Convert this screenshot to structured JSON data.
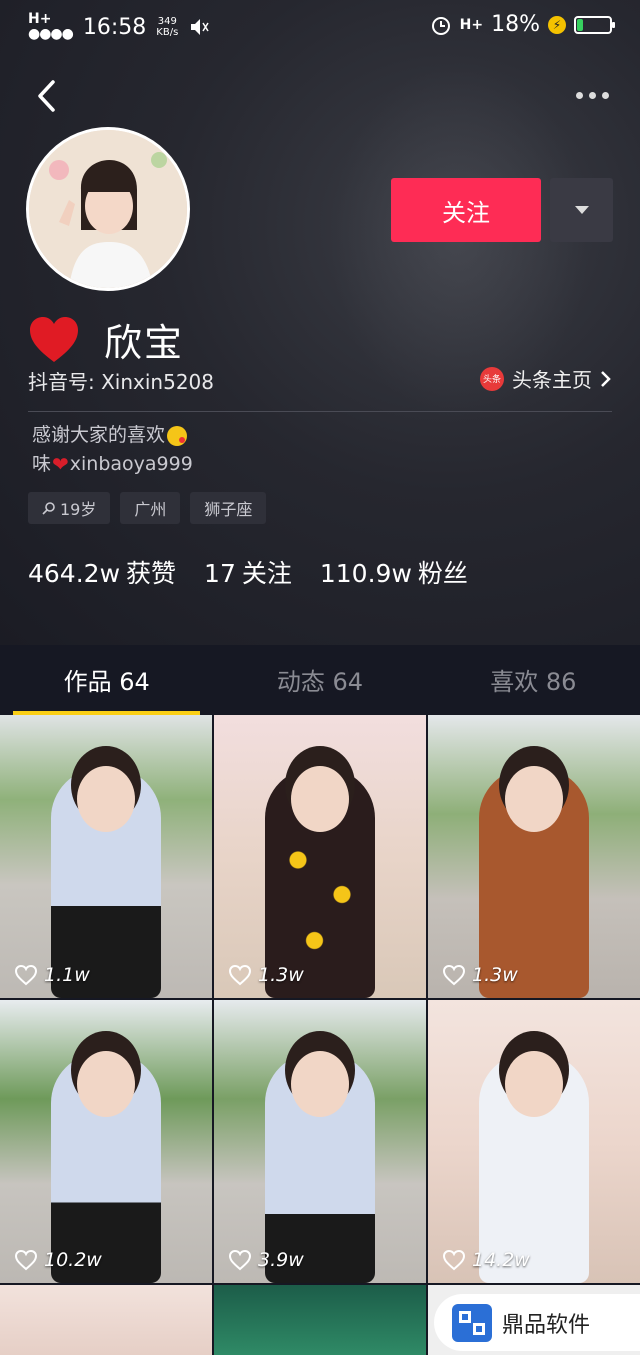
{
  "status_bar": {
    "network": "H+",
    "time": "16:58",
    "speed_value": "349",
    "speed_unit": "KB/s",
    "network2": "H+",
    "battery_percent": "18%",
    "battery_level": 0.18,
    "icons": [
      "signal-icon",
      "mute-icon",
      "alarm-icon",
      "charging-icon",
      "battery-icon"
    ]
  },
  "header": {
    "back_icon": "chevron-left-icon",
    "more_icon": "more-dots-icon"
  },
  "profile": {
    "follow_label": "关注",
    "nickname": "欣宝",
    "douyin_id": "抖音号: Xinxin5208",
    "toutiao_badge": "头条",
    "toutiao_label": "头条主页",
    "bio_line1": "感谢大家的喜欢",
    "bio_line2_prefix": "味",
    "bio_line2_suffix": "xinbaoya999",
    "tags": {
      "age": "19岁",
      "city": "广州",
      "zodiac": "狮子座"
    },
    "stats": {
      "likes_num": "464.2w",
      "likes_label": "获赞",
      "following_num": "17",
      "following_label": "关注",
      "fans_num": "110.9w",
      "fans_label": "粉丝"
    }
  },
  "tabs": [
    {
      "label": "作品 64",
      "active": true
    },
    {
      "label": "动态 64",
      "active": false
    },
    {
      "label": "喜欢 86",
      "active": false
    }
  ],
  "videos": [
    {
      "likes": "1.1w"
    },
    {
      "likes": "1.3w"
    },
    {
      "likes": "1.3w"
    },
    {
      "likes": "10.2w"
    },
    {
      "likes": "3.9w"
    },
    {
      "likes": "14.2w"
    }
  ],
  "watermark": {
    "text": "鼎品软件"
  },
  "colors": {
    "accent": "#fe2c55",
    "tab_indicator": "#face15",
    "background": "#161823"
  }
}
